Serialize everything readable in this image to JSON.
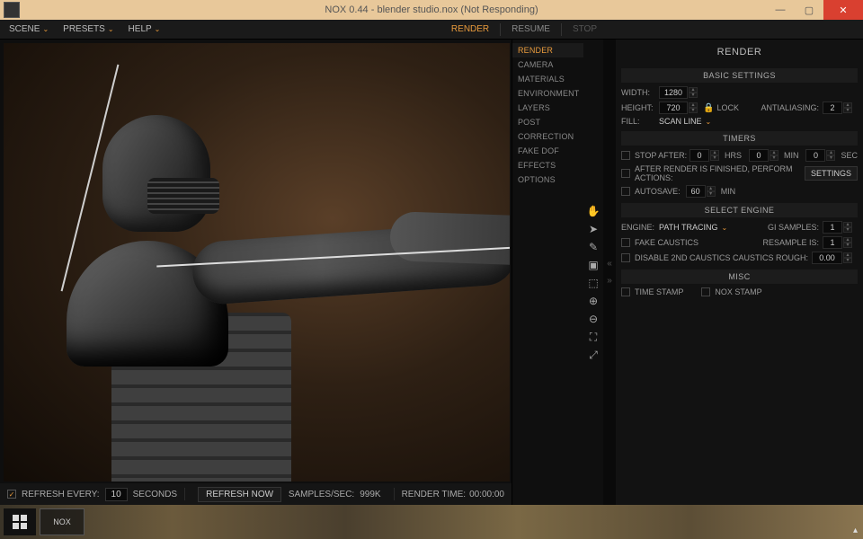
{
  "window": {
    "title": "NOX 0.44 - blender studio.nox (Not Responding)"
  },
  "menu": {
    "scene": "SCENE",
    "presets": "PRESETS",
    "help": "HELP",
    "tab_render": "RENDER",
    "tab_resume": "RESUME",
    "tab_stop": "STOP"
  },
  "categories": [
    "RENDER",
    "CAMERA",
    "MATERIALS",
    "ENVIRONMENT",
    "LAYERS",
    "POST",
    "CORRECTION",
    "FAKE DOF",
    "EFFECTS",
    "OPTIONS"
  ],
  "active_category_index": 0,
  "status": {
    "refresh_label": "REFRESH EVERY:",
    "refresh_value": "10",
    "refresh_unit": "SECONDS",
    "refresh_now": "REFRESH NOW",
    "samples_label": "SAMPLES/SEC:",
    "samples_value": "999K",
    "rendertime_label": "RENDER TIME:",
    "rendertime_value": "00:00:00"
  },
  "panel": {
    "title": "RENDER",
    "basic": {
      "header": "BASIC SETTINGS",
      "width_label": "WIDTH:",
      "width": "1280",
      "height_label": "HEIGHT:",
      "height": "720",
      "lock": "LOCK",
      "aa_label": "ANTIALIASING:",
      "aa": "2",
      "fill_label": "FILL:",
      "fill_value": "SCAN LINE"
    },
    "timers": {
      "header": "TIMERS",
      "stop_after": "STOP AFTER:",
      "hrs_v": "0",
      "hrs": "HRS",
      "min_v": "0",
      "min": "MIN",
      "sec_v": "0",
      "sec": "SEC",
      "after_render": "AFTER RENDER IS FINISHED, PERFORM ACTIONS:",
      "settings_btn": "SETTINGS",
      "autosave": "AUTOSAVE:",
      "autosave_v": "60",
      "autosave_u": "MIN"
    },
    "engine": {
      "header": "SELECT ENGINE",
      "engine_label": "ENGINE:",
      "engine_value": "PATH TRACING",
      "gi_label": "GI SAMPLES:",
      "gi_v": "1",
      "fake_caustics": "FAKE CAUSTICS",
      "resample_label": "RESAMPLE IS:",
      "resample_v": "1",
      "disable_2nd": "DISABLE 2ND CAUSTICS",
      "rough_label": "CAUSTICS ROUGH:",
      "rough_v": "0.00"
    },
    "misc": {
      "header": "MISC",
      "time_stamp": "TIME STAMP",
      "nox_stamp": "NOX STAMP"
    }
  },
  "taskbar": {
    "app": "NOX"
  }
}
